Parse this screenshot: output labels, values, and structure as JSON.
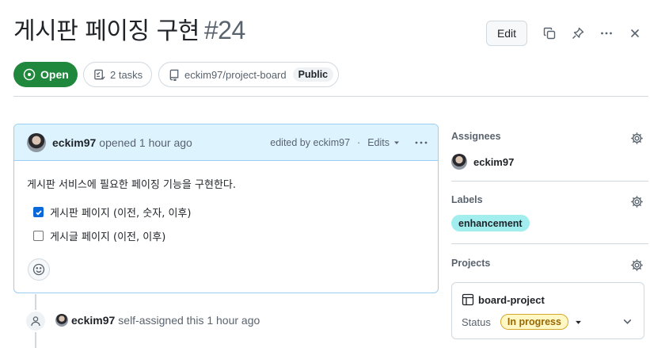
{
  "issue": {
    "title": "게시판 페이징 구현",
    "number": "#24",
    "state_label": "Open",
    "tasks_label": "2 tasks",
    "repo": "eckim97/project-board",
    "visibility": "Public",
    "edit_label": "Edit"
  },
  "comment": {
    "author": "eckim97",
    "action": "opened 1 hour ago",
    "edited_by": "edited by eckim97",
    "separator": "·",
    "edits_label": "Edits",
    "body": "게시판 서비스에 필요한 페이징 기능을 구현한다.",
    "tasks": [
      {
        "label": "게시판 페이지 (이전, 숫자, 이후)",
        "checked": true
      },
      {
        "label": "게시글 페이지 (이전, 이후)",
        "checked": false
      }
    ]
  },
  "timeline": {
    "actor": "eckim97",
    "event": "self-assigned this 1 hour ago"
  },
  "sidebar": {
    "assignees_heading": "Assignees",
    "assignee": "eckim97",
    "labels_heading": "Labels",
    "label": "enhancement",
    "projects_heading": "Projects",
    "project_name": "board-project",
    "status_label": "Status",
    "status_value": "In progress"
  },
  "colors": {
    "open_green": "#1f883d",
    "comment_header_bg": "#ddf4ff",
    "comment_border": "#9ccdf2",
    "label_enhancement": "#a2eeef",
    "status_in_progress": "#fff8c5"
  },
  "icons": [
    "issue-opened-icon",
    "checklist-icon",
    "repo-icon",
    "copy-icon",
    "pin-icon",
    "kebab-icon",
    "close-icon",
    "smiley-icon",
    "person-icon",
    "gear-icon",
    "table-icon",
    "caret-down-icon",
    "chevron-down-icon"
  ]
}
